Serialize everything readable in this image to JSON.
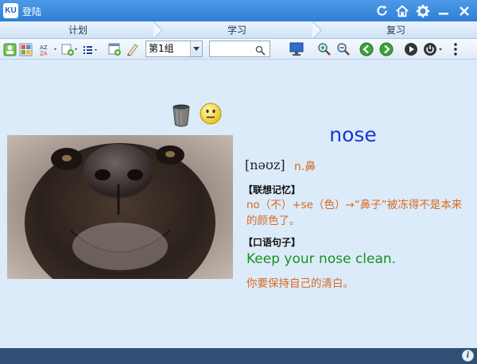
{
  "app": {
    "logo_text": "KU",
    "title": "登陆"
  },
  "steps": [
    "计划",
    "学习",
    "复习"
  ],
  "toolbar": {
    "group_select": "第1组",
    "search": {
      "value": "",
      "placeholder": ""
    }
  },
  "card": {
    "word": "nose",
    "phonetic": "[nəʊz]",
    "part_of_speech": "n.鼻",
    "assoc_label": "【联想记忆】",
    "assoc_text": "no（不）+se（色）→“鼻子”被冻得不是本来的颜色了。",
    "spoken_label": "【口语句子】",
    "sentence": "Keep your nose clean.",
    "translation": "你要保持自己的清白。"
  },
  "colors": {
    "titlebar": "#3a8ae0",
    "word": "#1436d8",
    "orange": "#d8691e",
    "green": "#13951c",
    "statusbar": "#2f5074",
    "content_bg": "#dcebfa"
  },
  "icons": [
    "refresh-icon",
    "home-icon",
    "gear-icon",
    "minimize-icon",
    "close-icon",
    "trash-icon",
    "smiley-icon",
    "info-icon"
  ]
}
